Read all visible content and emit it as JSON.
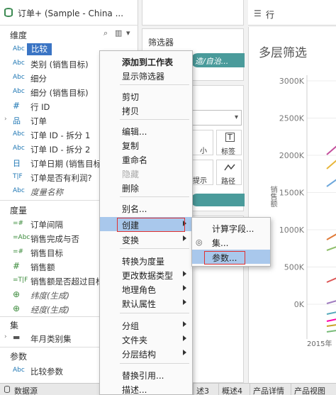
{
  "data_source": {
    "name": "订单+ (Sample - China ..."
  },
  "sections": {
    "dimensions": "维度",
    "measures": "度量",
    "sets": "集",
    "parameters": "参数"
  },
  "dimensions": [
    {
      "type": "Abc",
      "name": "比较"
    },
    {
      "type": "Abc",
      "name": "类别 (销售目标)"
    },
    {
      "type": "Abc",
      "name": "细分"
    },
    {
      "type": "Abc",
      "name": "细分 (销售目标)"
    },
    {
      "type": "#",
      "name": "行 ID"
    },
    {
      "type": "品",
      "name": "订单"
    },
    {
      "type": "Abc",
      "name": "订单 ID - 拆分 1"
    },
    {
      "type": "Abc",
      "name": "订单 ID - 拆分 2"
    },
    {
      "type": "日",
      "name": "订单日期 (销售目标)"
    },
    {
      "type": "T|F",
      "name": "订单是否有利润?"
    },
    {
      "type": "Abc",
      "name": "度量名称"
    }
  ],
  "measures": [
    {
      "type": "=#",
      "name": "订单间隔"
    },
    {
      "type": "=Abc",
      "name": "销售完成与否"
    },
    {
      "type": "=#",
      "name": "销售目标"
    },
    {
      "type": "#",
      "name": "销售额"
    },
    {
      "type": "=T|F",
      "name": "销售额是否超过目标"
    },
    {
      "type": "⊕",
      "name": "纬度(生成)"
    },
    {
      "type": "⊕",
      "name": "经度(生成)"
    }
  ],
  "sets": [
    {
      "name": "年月类别集"
    }
  ],
  "parameters": [
    {
      "type": "Abc",
      "name": "比较参数"
    }
  ],
  "shelves": {
    "filters": "筛选器",
    "filter_pill": "造/自治...",
    "rows_label": "行",
    "marks_size": "小",
    "marks_label": "标签",
    "marks_tooltip": "提示",
    "marks_path": "路径"
  },
  "chart": {
    "title": "多层筛选",
    "y_ticks": [
      "3000K",
      "2500K",
      "2000K",
      "1500K",
      "1000K",
      "500K",
      "0K"
    ],
    "y_axis_label": "销售额",
    "x_tick": "2015年"
  },
  "context_menu": {
    "items": [
      "添加到工作表",
      "显示筛选器",
      "剪切",
      "拷贝",
      "编辑...",
      "复制",
      "重命名",
      "隐藏",
      "删除",
      "别名...",
      "创建",
      "变换",
      "转换为度量",
      "更改数据类型",
      "地理角色",
      "默认属性",
      "分组",
      "文件夹",
      "分层结构",
      "替换引用...",
      "描述..."
    ]
  },
  "submenu": {
    "items": [
      "计算字段...",
      "集...",
      "参数..."
    ]
  },
  "tabs": [
    "数据源",
    "述3",
    "概述4",
    "产品详情",
    "产品视图"
  ],
  "colors": {
    "accent": "#3a74c4",
    "menu_highlight": "#a9c8ec",
    "red_box": "#e03030",
    "teal_pill": "#4a9b9b"
  }
}
